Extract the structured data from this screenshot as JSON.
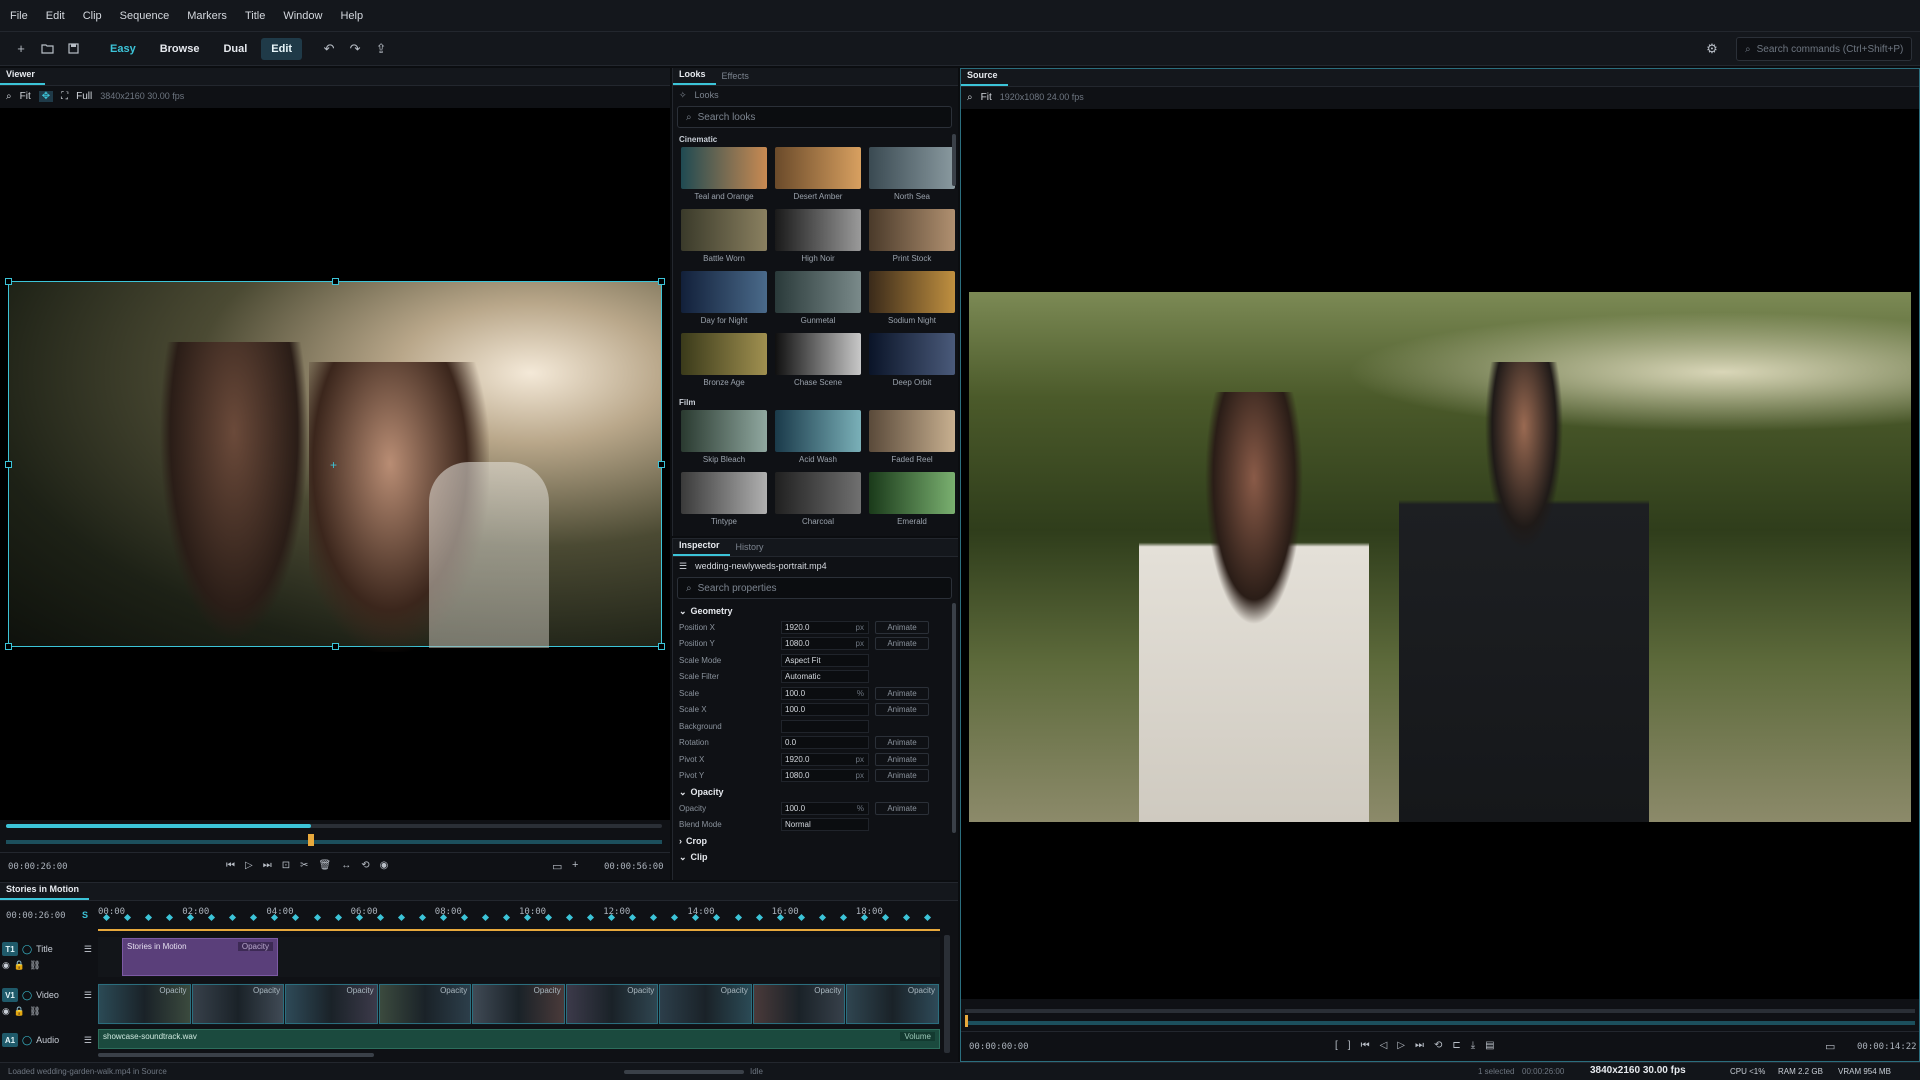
{
  "menu": [
    "File",
    "Edit",
    "Clip",
    "Sequence",
    "Markers",
    "Title",
    "Window",
    "Help"
  ],
  "toolbar": {
    "modes": [
      "Easy",
      "Browse",
      "Dual",
      "Edit"
    ],
    "active_mode": "Edit",
    "command_search_placeholder": "Search commands (Ctrl+Shift+P)"
  },
  "viewer": {
    "tab": "Viewer",
    "zoom": "Fit",
    "full_label": "Full",
    "meta": "3840x2160  30.00 fps",
    "timecode_current": "00:00:26:00",
    "timecode_end": "00:00:56:00",
    "playhead_progress": 0.465
  },
  "looks_panel": {
    "tabs": [
      "Looks",
      "Effects"
    ],
    "breadcrumb": "Looks",
    "search_placeholder": "Search looks",
    "sections": [
      {
        "name": "Cinematic",
        "looks": [
          "Teal and Orange",
          "Desert Amber",
          "North Sea",
          "Battle Worn",
          "High Noir",
          "Print Stock",
          "Day for Night",
          "Gunmetal",
          "Sodium Night",
          "Bronze Age",
          "Chase Scene",
          "Deep Orbit"
        ]
      },
      {
        "name": "Film",
        "looks": [
          "Skip Bleach",
          "Acid Wash",
          "Faded Reel",
          "Tintype",
          "Charcoal",
          "Emerald"
        ]
      }
    ]
  },
  "inspector": {
    "tabs": [
      "Inspector",
      "History"
    ],
    "file": "wedding-newlyweds-portrait.mp4",
    "search_placeholder": "Search properties",
    "animate_label": "Animate",
    "groups": {
      "geometry": "Geometry",
      "opacity": "Opacity",
      "crop": "Crop",
      "clip": "Clip"
    },
    "geometry_props": [
      {
        "name": "Position X",
        "value": "1920.0",
        "unit": "px",
        "anim": true
      },
      {
        "name": "Position Y",
        "value": "1080.0",
        "unit": "px",
        "anim": true
      },
      {
        "name": "Scale Mode",
        "value": "Aspect Fit",
        "unit": "",
        "anim": false
      },
      {
        "name": "Scale Filter",
        "value": "Automatic",
        "unit": "",
        "anim": false
      },
      {
        "name": "Scale",
        "value": "100.0",
        "unit": "%",
        "anim": true
      },
      {
        "name": "Scale X",
        "value": "100.0",
        "unit": "",
        "anim": true
      },
      {
        "name": "Background",
        "value": "",
        "unit": "",
        "anim": false
      },
      {
        "name": "Rotation",
        "value": "0.0",
        "unit": "",
        "anim": true
      },
      {
        "name": "Pivot X",
        "value": "1920.0",
        "unit": "px",
        "anim": true
      },
      {
        "name": "Pivot Y",
        "value": "1080.0",
        "unit": "px",
        "anim": true
      }
    ],
    "opacity_props": [
      {
        "name": "Opacity",
        "value": "100.0",
        "unit": "%",
        "anim": true
      },
      {
        "name": "Blend Mode",
        "value": "Normal",
        "unit": "",
        "anim": false
      }
    ]
  },
  "source": {
    "tab": "Source",
    "zoom": "Fit",
    "meta": "1920x1080  24.00 fps",
    "timecode_current": "00:00:00:00",
    "timecode_end": "00:00:14:22"
  },
  "timeline": {
    "tab": "Stories in Motion",
    "timecode": "00:00:26:00",
    "ruler": [
      "00:00",
      "02:00",
      "04:00",
      "06:00",
      "08:00",
      "10:00",
      "12:00",
      "14:00",
      "16:00",
      "18:00"
    ],
    "tracks": {
      "title": {
        "badge": "T1",
        "name": "Title",
        "clip": "Stories in Motion",
        "clip_tag": "Opacity"
      },
      "video": {
        "badge": "V1",
        "name": "Video",
        "clip_tag": "Opacity"
      },
      "audio": {
        "badge": "A1",
        "name": "Audio",
        "clip": "showcase-soundtrack.wav",
        "clip_tag": "Volume"
      }
    }
  },
  "status": {
    "message": "Loaded wedding-garden-walk.mp4 in Source",
    "state": "Idle",
    "selected": "1 selected",
    "duration": "00:00:26:00",
    "resolution": "3840x2160  30.00 fps",
    "cpu": "CPU <1%",
    "ram": "RAM 2.2 GB",
    "vram": "VRAM 954 MB"
  }
}
